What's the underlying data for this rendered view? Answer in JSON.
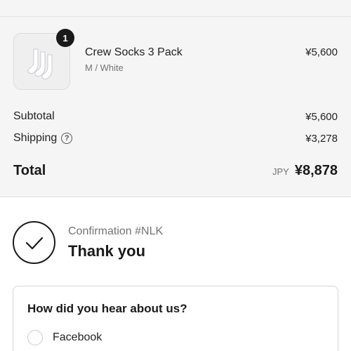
{
  "order_summary": {
    "item": {
      "name": "Crew Socks 3 Pack",
      "variant": "M / White",
      "price": "¥5,600",
      "quantity": "1",
      "image_icon": "socks-icon"
    },
    "subtotal": {
      "label": "Subtotal",
      "value": "¥5,600"
    },
    "shipping": {
      "label": "Shipping",
      "value": "¥3,278",
      "help_icon": "?"
    },
    "total": {
      "label": "Total",
      "currency": "JPY",
      "value": "¥8,878"
    }
  },
  "confirmation": {
    "number_text": "Confirmation #NLK",
    "thank_you": "Thank you",
    "icon": "check-icon"
  },
  "survey": {
    "title": "How did you hear about us?",
    "options": [
      "Facebook"
    ]
  }
}
